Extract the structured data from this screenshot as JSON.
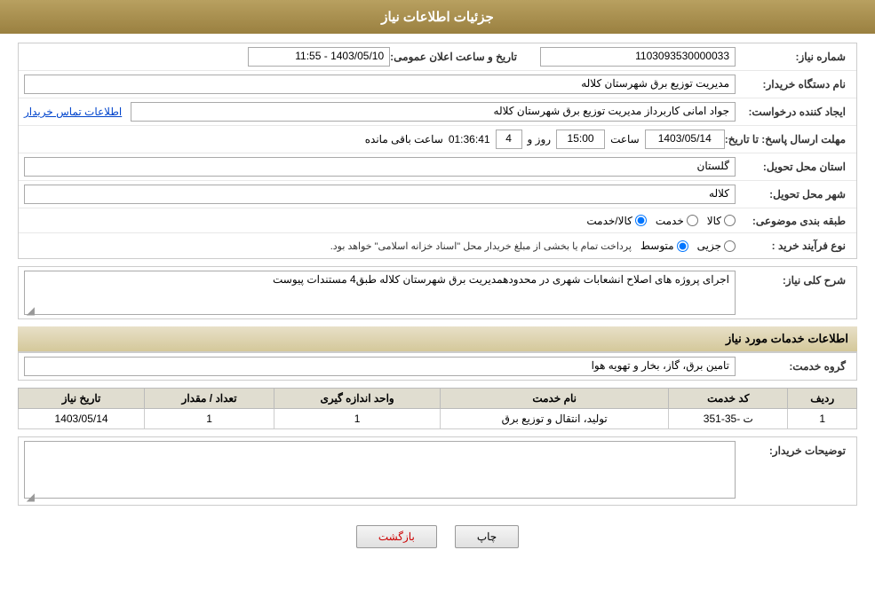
{
  "header": {
    "title": "جزئیات اطلاعات نیاز"
  },
  "form": {
    "need_number_label": "شماره نیاز:",
    "need_number_value": "1103093530000033",
    "date_label": "تاریخ و ساعت اعلان عمومی:",
    "date_value": "1403/05/10 - 11:55",
    "buyer_org_label": "نام دستگاه خریدار:",
    "buyer_org_value": "مدیریت توزیع برق شهرستان کلاله",
    "creator_label": "ایجاد کننده درخواست:",
    "creator_value": "جواد امانی کاربرداز مدیریت توزیع برق شهرستان کلاله",
    "contact_link": "اطلاعات تماس خریدار",
    "deadline_label": "مهلت ارسال پاسخ: تا تاریخ:",
    "deadline_date": "1403/05/14",
    "deadline_time_label": "ساعت",
    "deadline_time": "15:00",
    "deadline_days_label": "روز و",
    "deadline_days": "4",
    "deadline_remaining": "01:36:41",
    "deadline_remaining_label": "ساعت باقی مانده",
    "province_label": "استان محل تحویل:",
    "province_value": "گلستان",
    "city_label": "شهر محل تحویل:",
    "city_value": "کلاله",
    "category_label": "طبقه بندی موضوعی:",
    "category_options": [
      "کالا",
      "خدمت",
      "کالا/خدمت"
    ],
    "category_selected": "کالا",
    "purchase_type_label": "نوع فرآیند خرید :",
    "purchase_type_options": [
      "جزیی",
      "متوسط"
    ],
    "purchase_type_note": "پرداخت تمام یا بخشی از مبلغ خریدار محل \"اسناد خزانه اسلامی\" خواهد بود.",
    "description_label": "شرح کلی نیاز:",
    "description_value": "اجرای پروژه های اصلاح انشعابات شهری در محدودهمدیریت برق شهرستان کلاله طبق4 مستندات پیوست",
    "services_header": "اطلاعات خدمات مورد نیاز",
    "service_group_label": "گروه خدمت:",
    "service_group_value": "تامین برق، گاز، بخار و تهویه هوا",
    "table": {
      "columns": [
        "ردیف",
        "کد خدمت",
        "نام خدمت",
        "واحد اندازه گیری",
        "تعداد / مقدار",
        "تاریخ نیاز"
      ],
      "rows": [
        {
          "row": "1",
          "code": "ت -35-351",
          "name": "تولید، انتقال و توزیع برق",
          "unit": "1",
          "quantity": "1",
          "date": "1403/05/14"
        }
      ]
    },
    "buyer_notes_label": "توضیحات خریدار:",
    "buyer_notes_value": ""
  },
  "buttons": {
    "print_label": "چاپ",
    "back_label": "بازگشت"
  }
}
